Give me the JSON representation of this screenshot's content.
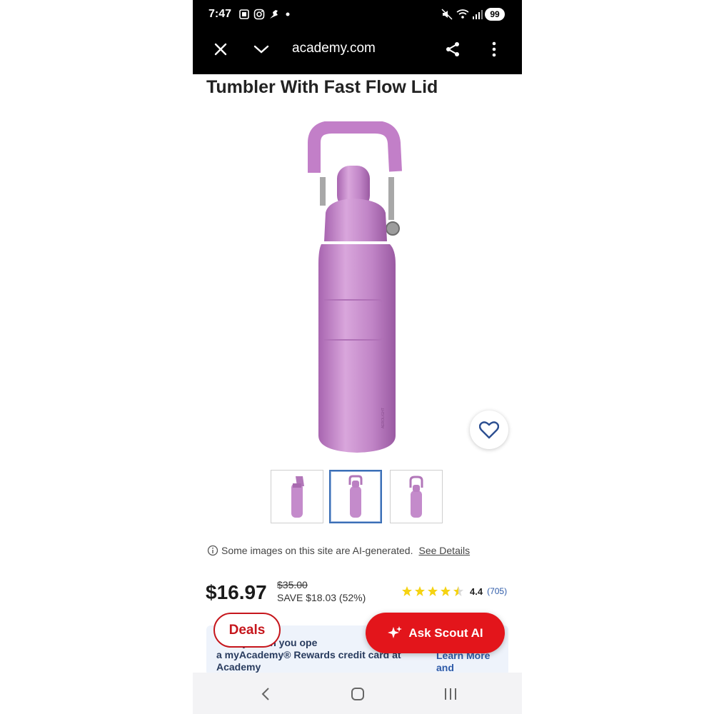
{
  "status_bar": {
    "time": "7:47",
    "battery": "99",
    "icons": [
      "screenshot-icon",
      "instagram-icon",
      "bird-icon",
      "dot-icon",
      "mute-icon",
      "wifi-icon",
      "signal-icon"
    ]
  },
  "browser": {
    "url": "academy.com",
    "icons": [
      "close-icon",
      "chevron-down-icon",
      "share-icon",
      "more-vertical-icon"
    ]
  },
  "product": {
    "title": "Tumbler With Fast Flow Lid",
    "color": "#c98fcf",
    "thumbnails_count": 3,
    "selected_thumbnail": 2
  },
  "ai_notice": {
    "text": "Some images on this site are AI-generated.",
    "link": "See Details"
  },
  "price": {
    "current": "$16.97",
    "original": "$35.00",
    "save": "SAVE $18.03 (52%)"
  },
  "rating": {
    "stars": 4.5,
    "value": "4.4",
    "count": "(705)"
  },
  "credit_banner": {
    "text": "S       day when you ope… a myAcademy® Rewards credit card at Academy",
    "line1": "day when you ope",
    "line2": "a myAcademy® Rewards credit card at",
    "line3": "Academy",
    "learn_more": "Learn More",
    "and": "and"
  },
  "buttons": {
    "deals": "Deals",
    "ask_scout": "Ask Scout AI"
  },
  "colors": {
    "accent_red": "#e3151b",
    "link_blue": "#2d5aa8",
    "star_yellow": "#f5d312"
  }
}
